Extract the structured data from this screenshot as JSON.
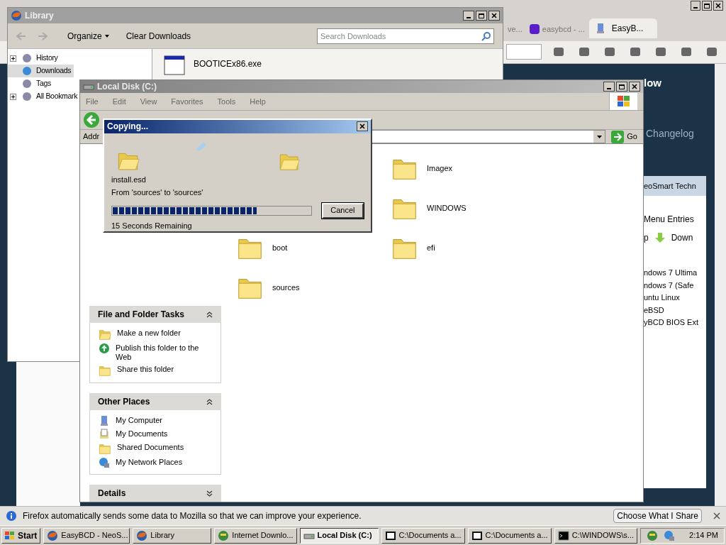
{
  "browser": {
    "tabs": [
      {
        "label": "ve...",
        "selected": false
      },
      {
        "label": "easybcd - ...",
        "selected": false
      },
      {
        "label": "EasyB...",
        "selected": true
      }
    ],
    "page": {
      "heading": "low",
      "link": "Changelog",
      "app_title": "eoSmart Techn",
      "menu_label": "Menu Entries",
      "buttons": [
        "p",
        "Down"
      ],
      "entries": [
        "ndows 7 Ultima",
        "ndows 7 (Safe",
        "untu Linux",
        "eBSD",
        "yBCD BIOS Ext"
      ]
    }
  },
  "library": {
    "title": "Library",
    "organize": "Organize",
    "clear": "Clear Downloads",
    "search_placeholder": "Search Downloads",
    "tree": [
      {
        "label": "History",
        "expandable": true,
        "selected": false
      },
      {
        "label": "Downloads",
        "expandable": false,
        "selected": true
      },
      {
        "label": "Tags",
        "expandable": false,
        "selected": false
      },
      {
        "label": "All Bookmark",
        "expandable": true,
        "selected": false
      }
    ],
    "downloads": [
      {
        "name": "BOOTICEx86.exe"
      }
    ]
  },
  "explorer": {
    "title": "Local Disk (C:)",
    "menu": [
      "File",
      "Edit",
      "View",
      "Favorites",
      "Tools",
      "Help"
    ],
    "address_label": "Addr",
    "go": "Go",
    "panels": [
      {
        "title": "File and Folder Tasks",
        "expanded": true,
        "items": [
          {
            "label": "Make a new folder",
            "kind": "newfolder"
          },
          {
            "label": "Publish this folder to the Web",
            "kind": "publish"
          },
          {
            "label": "Share this folder",
            "kind": "share"
          }
        ]
      },
      {
        "title": "Other Places",
        "expanded": true,
        "items": [
          {
            "label": "My Computer",
            "kind": "computer"
          },
          {
            "label": "My Documents",
            "kind": "documents"
          },
          {
            "label": "Shared Documents",
            "kind": "folder"
          },
          {
            "label": "My Network Places",
            "kind": "network"
          }
        ]
      },
      {
        "title": "Details",
        "expanded": false
      }
    ],
    "folders": [
      {
        "name": "Imagex"
      },
      {
        "name": "WINDOWS"
      },
      {
        "name": "boot"
      },
      {
        "name": "efi"
      },
      {
        "name": "sources"
      }
    ]
  },
  "copy_dialog": {
    "title": "Copying...",
    "file": "install.esd",
    "from_to": "From 'sources' to 'sources'",
    "progress": {
      "level": 0.73
    },
    "remaining": "15 Seconds Remaining",
    "cancel": "Cancel"
  },
  "notification": {
    "text": "Firefox automatically sends some data to Mozilla so that we can improve your experience.",
    "button": "Choose What I Share"
  },
  "taskbar": {
    "start": "Start",
    "tasks": [
      {
        "label": "EasyBCD - NeoS...",
        "kind": "browser",
        "selected": false
      },
      {
        "label": "Library",
        "kind": "browser",
        "selected": false
      },
      {
        "label": "Internet Downlo...",
        "kind": "globe",
        "selected": false
      },
      {
        "label": "Local Disk (C:)",
        "kind": "drive",
        "selected": true
      },
      {
        "label": "C:\\Documents a...",
        "kind": "archive",
        "selected": false
      },
      {
        "label": "C:\\Documents a...",
        "kind": "archive",
        "selected": false
      },
      {
        "label": "C:\\WINDOWS\\s...",
        "kind": "console",
        "selected": false
      }
    ],
    "clock": "2:14 PM"
  }
}
